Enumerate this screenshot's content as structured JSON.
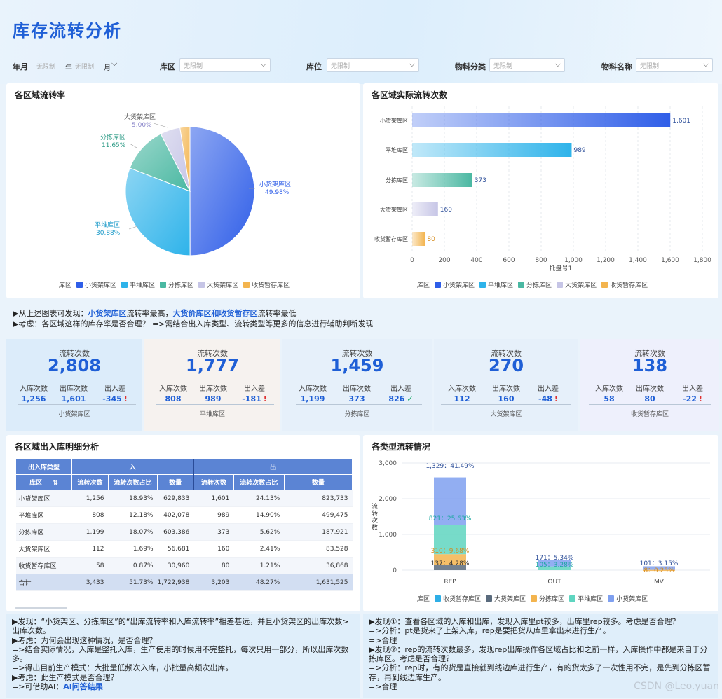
{
  "header": {
    "title": "库存流转分析"
  },
  "filters": {
    "year_month_label": "年月",
    "year_value": "无限制",
    "year_unit": "年",
    "month_value": "无限制",
    "month_unit": "月",
    "zone_label": "库区",
    "zone_value": "无限制",
    "location_label": "库位",
    "location_value": "无限制",
    "category_label": "物料分类",
    "category_value": "无限制",
    "material_label": "物料名称",
    "material_value": "无限制"
  },
  "pie_card": {
    "title": "各区域流转率",
    "legend_title": "库区",
    "labels": [
      {
        "name": "小货架库区",
        "pct": "49.98%"
      },
      {
        "name": "平堆库区",
        "pct": "30.88%"
      },
      {
        "name": "分拣库区",
        "pct": "11.65%"
      },
      {
        "name": "大货架库区",
        "pct": "5.00%"
      }
    ]
  },
  "bar_card": {
    "title": "各区域实际流转次数",
    "legend_title": "库区",
    "xlabel": "托盘号1"
  },
  "legend_items": [
    {
      "name": "小货架库区",
      "color": "#2f5ee8"
    },
    {
      "name": "平堆库区",
      "color": "#2eb3ea"
    },
    {
      "name": "分拣库区",
      "color": "#4ab8a2"
    },
    {
      "name": "大货架库区",
      "color": "#c6c5e6"
    },
    {
      "name": "收货暂存库区",
      "color": "#f3b44e"
    }
  ],
  "chart_data": [
    {
      "type": "pie",
      "title": "各区域流转率",
      "categories": [
        "小货架库区",
        "平堆库区",
        "分拣库区",
        "大货架库区",
        "收货暂存库区"
      ],
      "values": [
        49.98,
        30.88,
        11.65,
        5.0,
        2.49
      ],
      "colors": [
        "#2f5ee8",
        "#2eb3ea",
        "#4ab8a2",
        "#c6c5e6",
        "#f3b44e"
      ]
    },
    {
      "type": "bar",
      "orientation": "horizontal",
      "title": "各区域实际流转次数",
      "categories": [
        "小货架库区",
        "平堆库区",
        "分拣库区",
        "大货架库区",
        "收货暂存库区"
      ],
      "values": [
        1601,
        989,
        373,
        160,
        80
      ],
      "value_labels": [
        "1,601",
        "989",
        "373",
        "160",
        "80"
      ],
      "xlabel": "托盘号1",
      "xlim": [
        0,
        1800
      ],
      "xticks": [
        0,
        200,
        400,
        600,
        800,
        1000,
        1200,
        1400,
        1600,
        1800
      ],
      "xtick_labels": [
        "0",
        "200",
        "400",
        "600",
        "800",
        "1,000",
        "1,200",
        "1,400",
        "1,600",
        "1,800"
      ],
      "colors": [
        "#2f5ee8",
        "#2eb3ea",
        "#4ab8a2",
        "#c6c5e6",
        "#f3b44e"
      ]
    },
    {
      "type": "bar",
      "stacked": true,
      "title": "各类型流转情况",
      "ylabel": "流转次数",
      "categories": [
        "REP",
        "OUT",
        "MV"
      ],
      "ylim": [
        0,
        3000
      ],
      "yticks": [
        0,
        1000,
        2000,
        3000
      ],
      "ytick_labels": [
        "0",
        "1,000",
        "2,000",
        "3,000"
      ],
      "series": [
        {
          "name": "收货暂存库区",
          "color": "#2eaee6",
          "values": [
            0,
            0,
            0
          ]
        },
        {
          "name": "大货架库区",
          "color": "#5a6b7d",
          "values": [
            137,
            0,
            0
          ]
        },
        {
          "name": "分拣库区",
          "color": "#f3b44e",
          "values": [
            310,
            0,
            8
          ]
        },
        {
          "name": "平堆库区",
          "color": "#5fd5c0",
          "values": [
            821,
            105,
            0
          ]
        },
        {
          "name": "小货架库区",
          "color": "#7fa0f0",
          "values": [
            1329,
            171,
            101
          ]
        }
      ],
      "data_labels": [
        "1,329：41.49%",
        "821：25.63%",
        "310：9.68%",
        "137：4.28%",
        "171：5.34%",
        "105：3.28%",
        "101：3.15%",
        "8：0.25%"
      ]
    }
  ],
  "stack_card": {
    "title": "各类型流转情况",
    "legend_title": "库区",
    "ylabel": "流转次数"
  },
  "findings": {
    "l1_prefix": "▶从上述图表可发现：",
    "l1_a": "小货架库区",
    "l1_b": "流转率最高，",
    "l1_c": "大货价库区和收货暂存区",
    "l1_d": "流转率最低",
    "l2": "▶考虑：各区域这样的库存率是否合理？ =>需结合出入库类型、流转类型等更多的信息进行辅助判断发现"
  },
  "kpis": [
    {
      "label": "流转次数",
      "value": "2,808",
      "in_label": "入库次数",
      "in": "1,256",
      "out_label": "出库次数",
      "out": "1,601",
      "diff_label": "出入差",
      "diff": "-345",
      "flag": "!",
      "name": "小货架库区"
    },
    {
      "label": "流转次数",
      "value": "1,777",
      "in_label": "入库次数",
      "in": "808",
      "out_label": "出库次数",
      "out": "989",
      "diff_label": "出入差",
      "diff": "-181",
      "flag": "!",
      "name": "平堆库区"
    },
    {
      "label": "流转次数",
      "value": "1,459",
      "in_label": "入库次数",
      "in": "1,199",
      "out_label": "出库次数",
      "out": "373",
      "diff_label": "出入差",
      "diff": "826",
      "flag": "✓",
      "name": "分拣库区"
    },
    {
      "label": "流转次数",
      "value": "270",
      "in_label": "入库次数",
      "in": "112",
      "out_label": "出库次数",
      "out": "160",
      "diff_label": "出入差",
      "diff": "-48",
      "flag": "!",
      "name": "大货架库区"
    },
    {
      "label": "流转次数",
      "value": "138",
      "in_label": "入库次数",
      "in": "58",
      "out_label": "出库次数",
      "out": "80",
      "diff_label": "出入差",
      "diff": "-22",
      "flag": "!",
      "name": "收货暂存库区"
    }
  ],
  "table": {
    "title": "各区域出入库明细分析",
    "h_type": "出入库类型",
    "h_in": "入",
    "h_out": "出",
    "h_zone": "库区",
    "h_sort": "⇅",
    "h_cnt": "流转次数",
    "h_pct": "流转次数占比",
    "h_qty": "数量",
    "rows": [
      [
        "小货架库区",
        "1,256",
        "18.93%",
        "629,833",
        "1,601",
        "24.13%",
        "823,733"
      ],
      [
        "平堆库区",
        "808",
        "12.18%",
        "402,078",
        "989",
        "14.90%",
        "499,475"
      ],
      [
        "分拣库区",
        "1,199",
        "18.07%",
        "603,386",
        "373",
        "5.62%",
        "187,921"
      ],
      [
        "大货架库区",
        "112",
        "1.69%",
        "56,681",
        "160",
        "2.41%",
        "83,528"
      ],
      [
        "收货暂存库区",
        "58",
        "0.87%",
        "30,960",
        "80",
        "1.21%",
        "36,868"
      ]
    ],
    "total": [
      "合计",
      "3,433",
      "51.73%",
      "1,722,938",
      "3,203",
      "48.27%",
      "1,631,525"
    ]
  },
  "analysis_left": {
    "l1": "▶发现：“小货架区、分拣库区”的“出库流转率和入库流转率”相差甚远，并且小货架区的出库次数>出库次数。",
    "l2": "▶考虑：为何会出现这种情况，是否合理？",
    "l3": "=>结合实际情况，入库是整托入库，生产使用的时候用不完整托，每次只用一部分，所以出库次数多。",
    "l4": "=>得出目前生产模式：大批量低频次入库，小批量高频次出库。",
    "l5": "▶考虑：此生产模式是否合理？",
    "l6_prefix": "=>可借助AI：",
    "l6_link": "AI问答结果"
  },
  "analysis_right": {
    "l1": "▶发现①：查看各区域的入库和出库，发现入库里pt较多，出库里rep较多。考虑是否合理？",
    "l2": "=>分析：pt是货来了上架入库，rep是要把货从库里拿出来进行生产。",
    "l3": "=>合理",
    "l4": "▶发现②：rep的流转次数最多，发现rep出库操作各区域占比和之前一样，入库操作中都是来自于分拣库区。考虑是否合理？",
    "l5": "=>分析：rep时，有的货是直接就到线边库进行生产，有的货太多了一次性用不完，是先到分拣区暂存，再到线边库生产。",
    "l6": "=>合理"
  },
  "watermark": "CSDN @Leo.yuan"
}
